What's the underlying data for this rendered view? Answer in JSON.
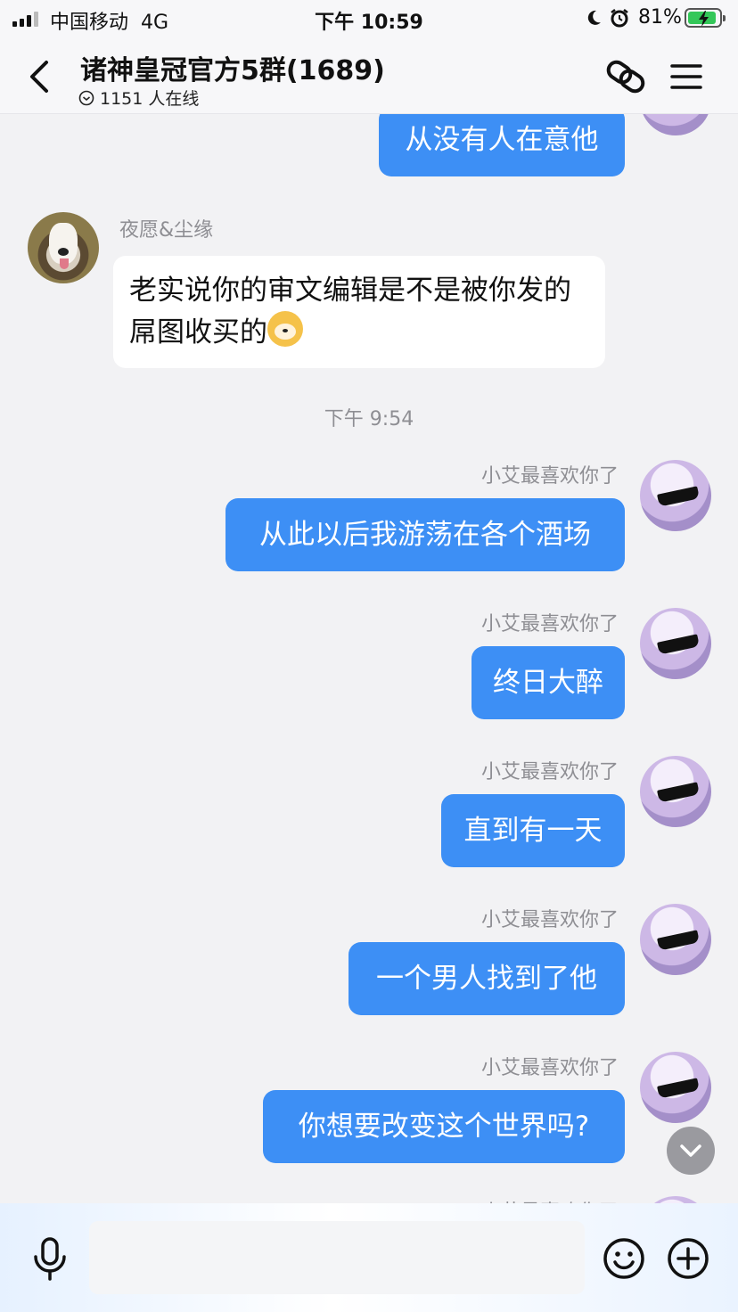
{
  "status_bar": {
    "carrier": "中国移动",
    "network": "4G",
    "time": "下午 10:59",
    "battery_percent": "81%"
  },
  "header": {
    "title": "诸神皇冠官方5群(1689)",
    "online_count": "1151 人在线"
  },
  "messages": {
    "m0": {
      "text": "从没有人在意他"
    },
    "m1": {
      "sender": "夜愿&尘缘",
      "text": "老实说你的审文编辑是不是被你发的屌图收买的"
    },
    "timestamp": "下午 9:54",
    "m2": {
      "sender": "小艾最喜欢你了",
      "text": "从此以后我游荡在各个酒场"
    },
    "m3": {
      "sender": "小艾最喜欢你了",
      "text": "终日大醉"
    },
    "m4": {
      "sender": "小艾最喜欢你了",
      "text": "直到有一天"
    },
    "m5": {
      "sender": "小艾最喜欢你了",
      "text": "一个男人找到了他"
    },
    "m6": {
      "sender": "小艾最喜欢你了",
      "text": "你想要改变这个世界吗?"
    },
    "m7": {
      "sender": "小艾最喜欢你了"
    }
  },
  "input": {
    "value": ""
  },
  "icons": {
    "back": "chevron-left-icon",
    "link": "link-icon",
    "menu": "menu-icon",
    "mic": "microphone-icon",
    "emoji": "smiley-icon",
    "plus": "plus-circle-icon",
    "scroll": "chevron-down-icon"
  },
  "colors": {
    "my_bubble": "#3d8ff5",
    "other_bubble": "#ffffff",
    "background": "#f2f2f4"
  }
}
